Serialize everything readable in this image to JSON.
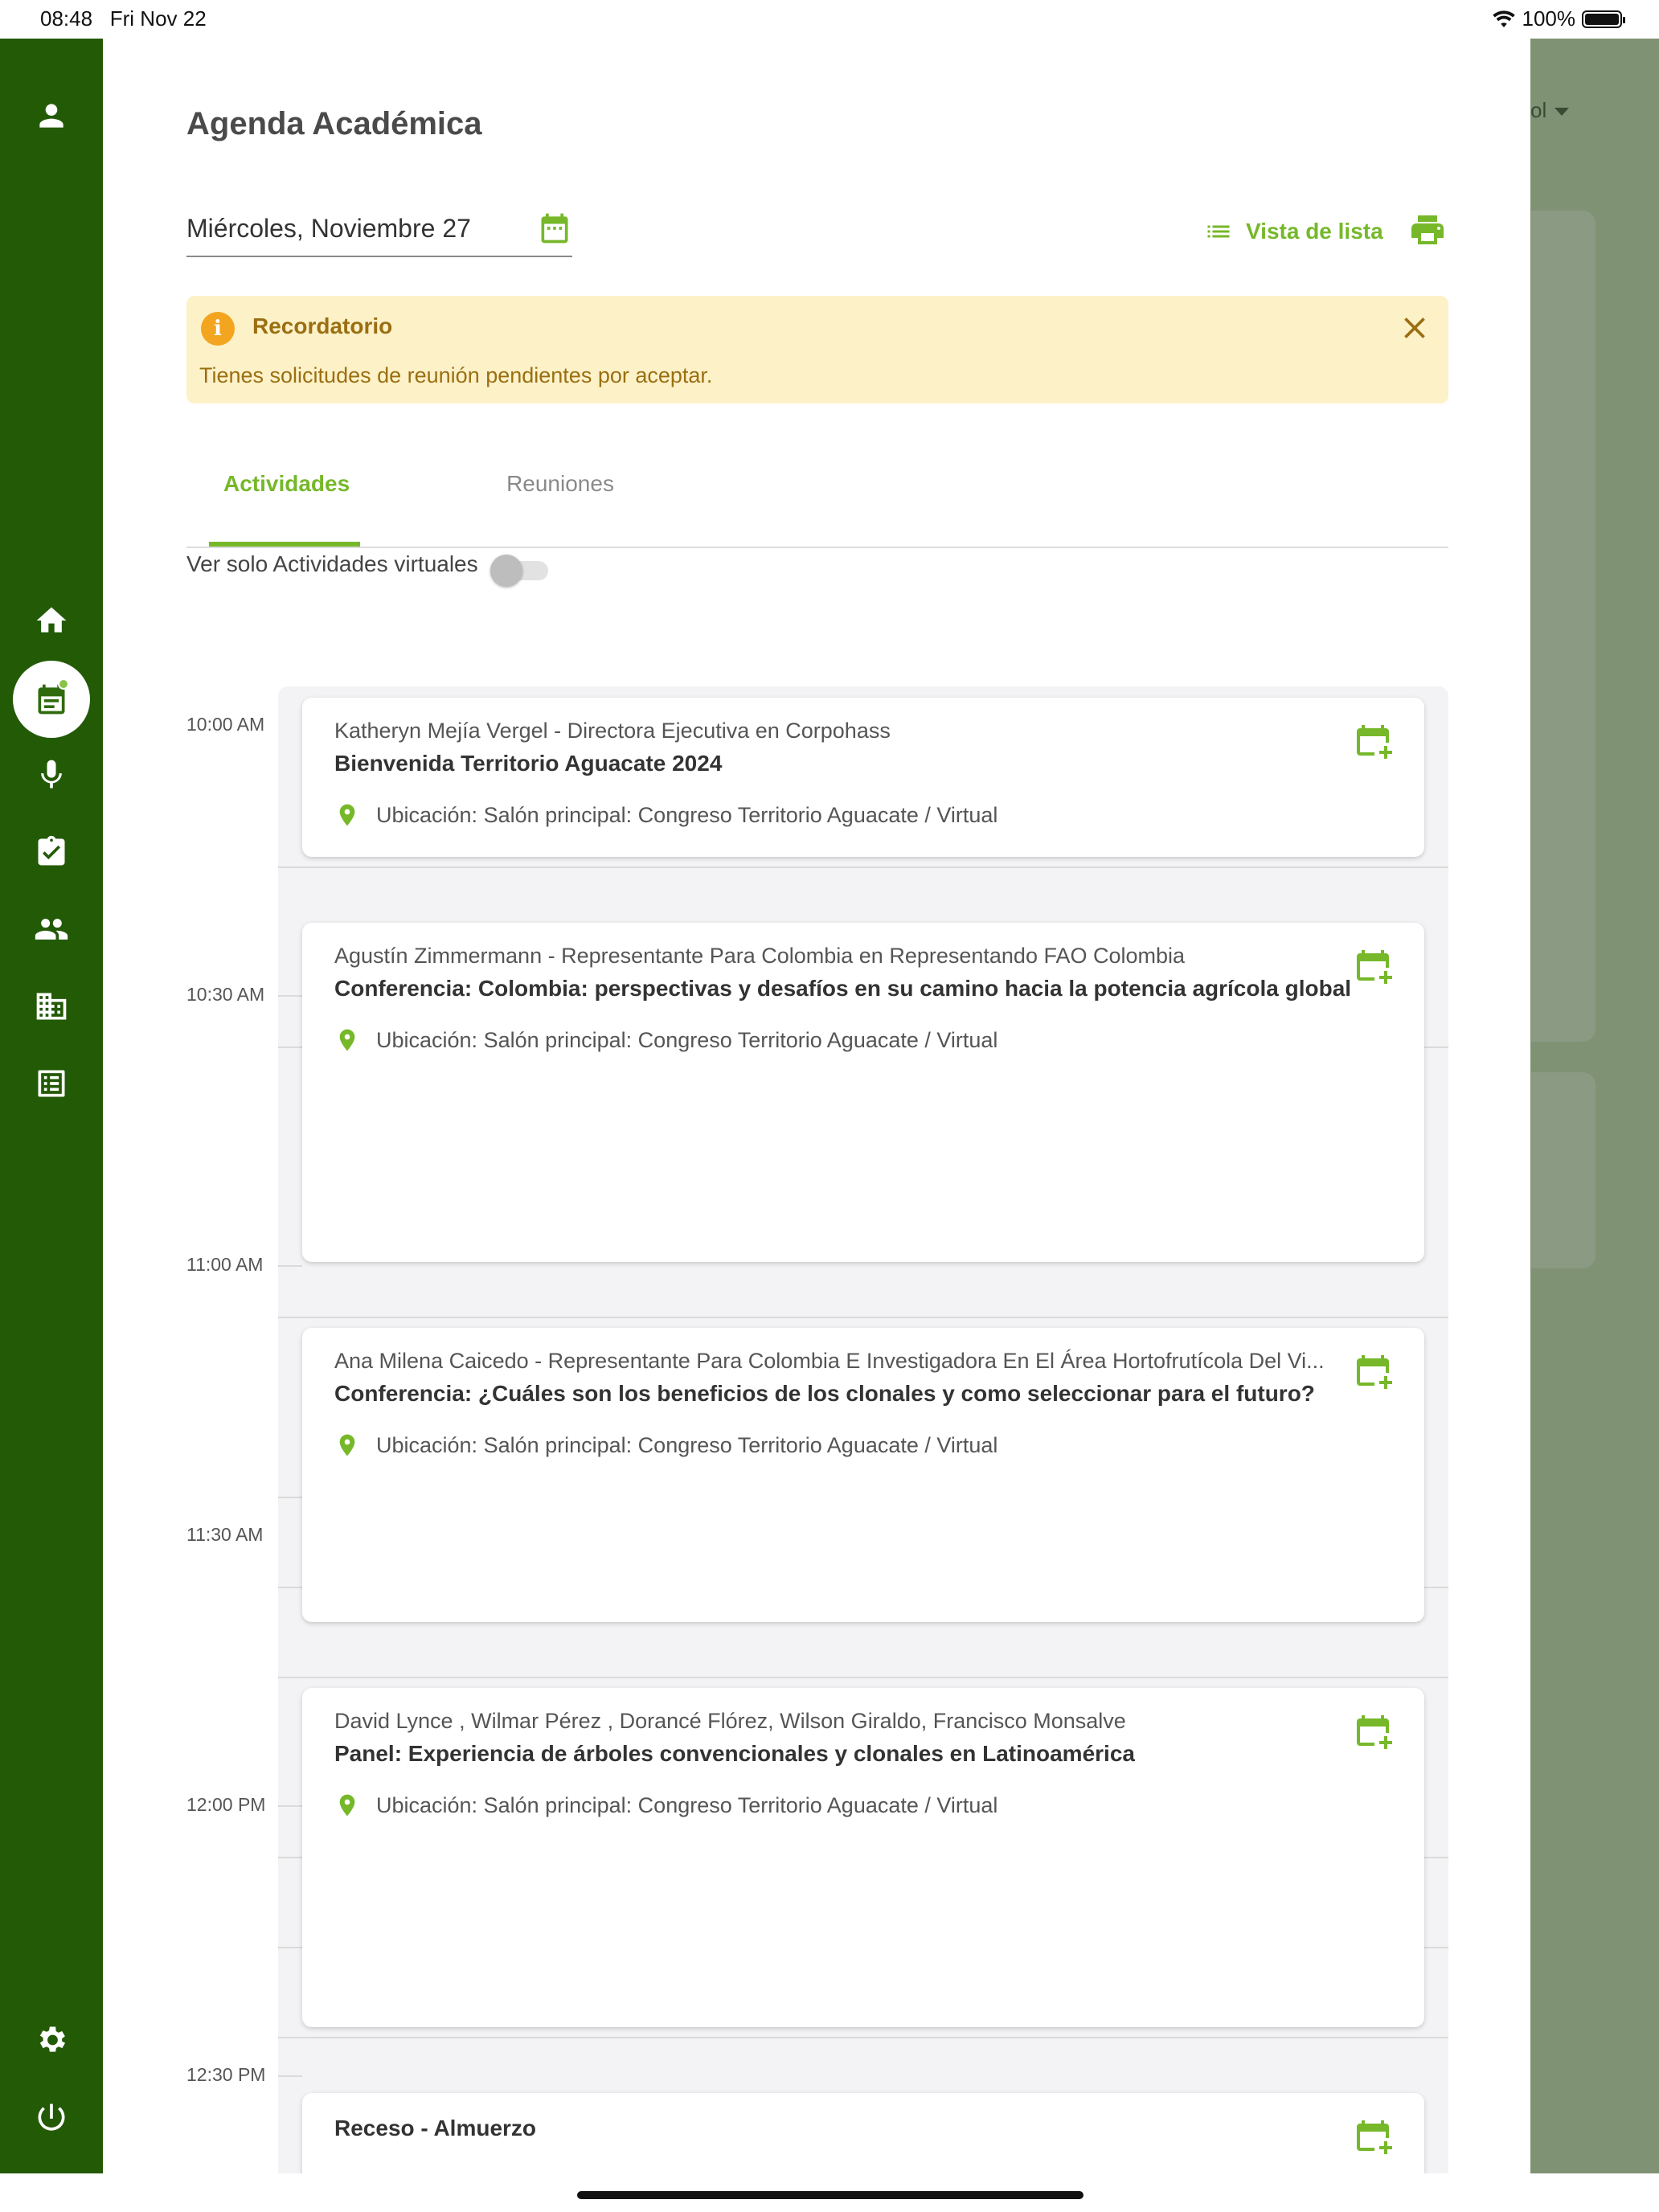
{
  "status_bar": {
    "time": "08:48",
    "date": "Fri Nov 22",
    "battery": "100%"
  },
  "backdrop": {
    "partial_text": "ol"
  },
  "page": {
    "title": "Agenda Académica"
  },
  "date_picker": {
    "value": "Miércoles, Noviembre 27"
  },
  "toolbar": {
    "list_view_label": "Vista de lista"
  },
  "reminder": {
    "title": "Recordatorio",
    "message": "Tienes solicitudes de reunión pendientes por aceptar.",
    "info_glyph": "i"
  },
  "tabs": [
    {
      "label": "Actividades",
      "active": true
    },
    {
      "label": "Reuniones",
      "active": false
    }
  ],
  "filter": {
    "virtual_only_label": "Ver solo Actividades virtuales",
    "virtual_only_on": false
  },
  "times": [
    "10:00 AM",
    "10:30 AM",
    "11:00 AM",
    "11:30 AM",
    "12:00 PM",
    "12:30 PM"
  ],
  "activities": [
    {
      "speaker": "Katheryn Mejía Vergel - Directora Ejecutiva en Corpohass",
      "title": "Bienvenida Territorio Aguacate 2024",
      "location": "Ubicación: Salón principal: Congreso Territorio Aguacate / Virtual"
    },
    {
      "speaker": "Agustín Zimmermann - Representante Para Colombia en Representando FAO Colombia",
      "title": "Conferencia: Colombia: perspectivas y desafíos en su camino hacia la potencia agrícola global",
      "location": "Ubicación: Salón principal: Congreso Territorio Aguacate / Virtual"
    },
    {
      "speaker": "Ana Milena Caicedo - Representante Para Colombia E Investigadora En El Área Hortofrutícola Del Vi...",
      "title": "Conferencia: ¿Cuáles son los beneficios de los clonales y como seleccionar para el futuro?",
      "location": "Ubicación: Salón principal: Congreso Territorio Aguacate / Virtual"
    },
    {
      "speaker": "David Lynce , Wilmar Pérez , Dorancé Flórez, Wilson Giraldo, Francisco Monsalve",
      "title": "Panel: Experiencia de árboles convencionales y clonales en Latinoamérica",
      "location": "Ubicación: Salón principal: Congreso Territorio Aguacate / Virtual"
    },
    {
      "title": "Receso - Almuerzo"
    }
  ],
  "colors": {
    "sidebar": "#235a06",
    "accent": "#76b82a",
    "reminder_bg": "#fdf1c8",
    "reminder_text": "#9a6f12"
  }
}
